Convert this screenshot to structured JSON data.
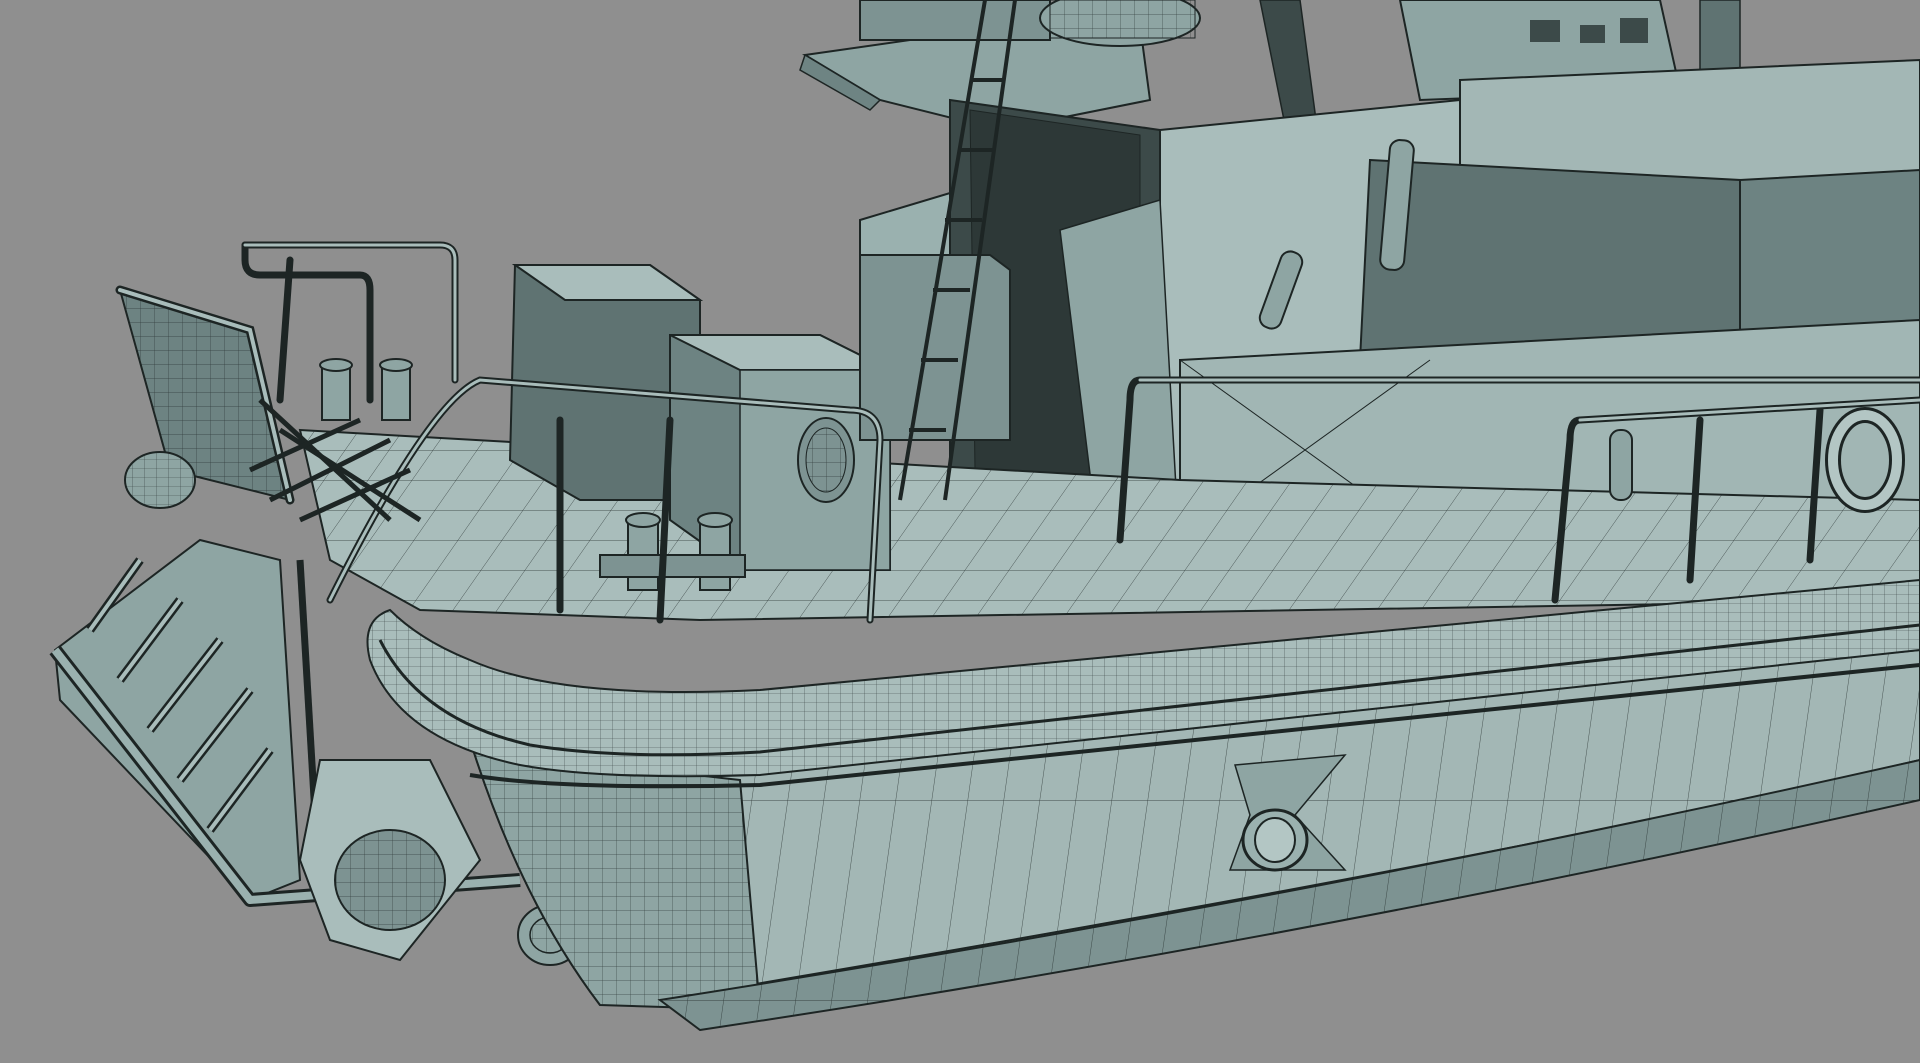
{
  "scene": {
    "subject": "wireframe-render-boat-stern",
    "colors": {
      "background": "#8f8f8f",
      "hull_light": "#a9bdbb",
      "hull_mid": "#8ea5a3",
      "hull_dark": "#5f7372",
      "cabin_shadow": "#3c4a49",
      "wire": "#1d2524"
    }
  }
}
